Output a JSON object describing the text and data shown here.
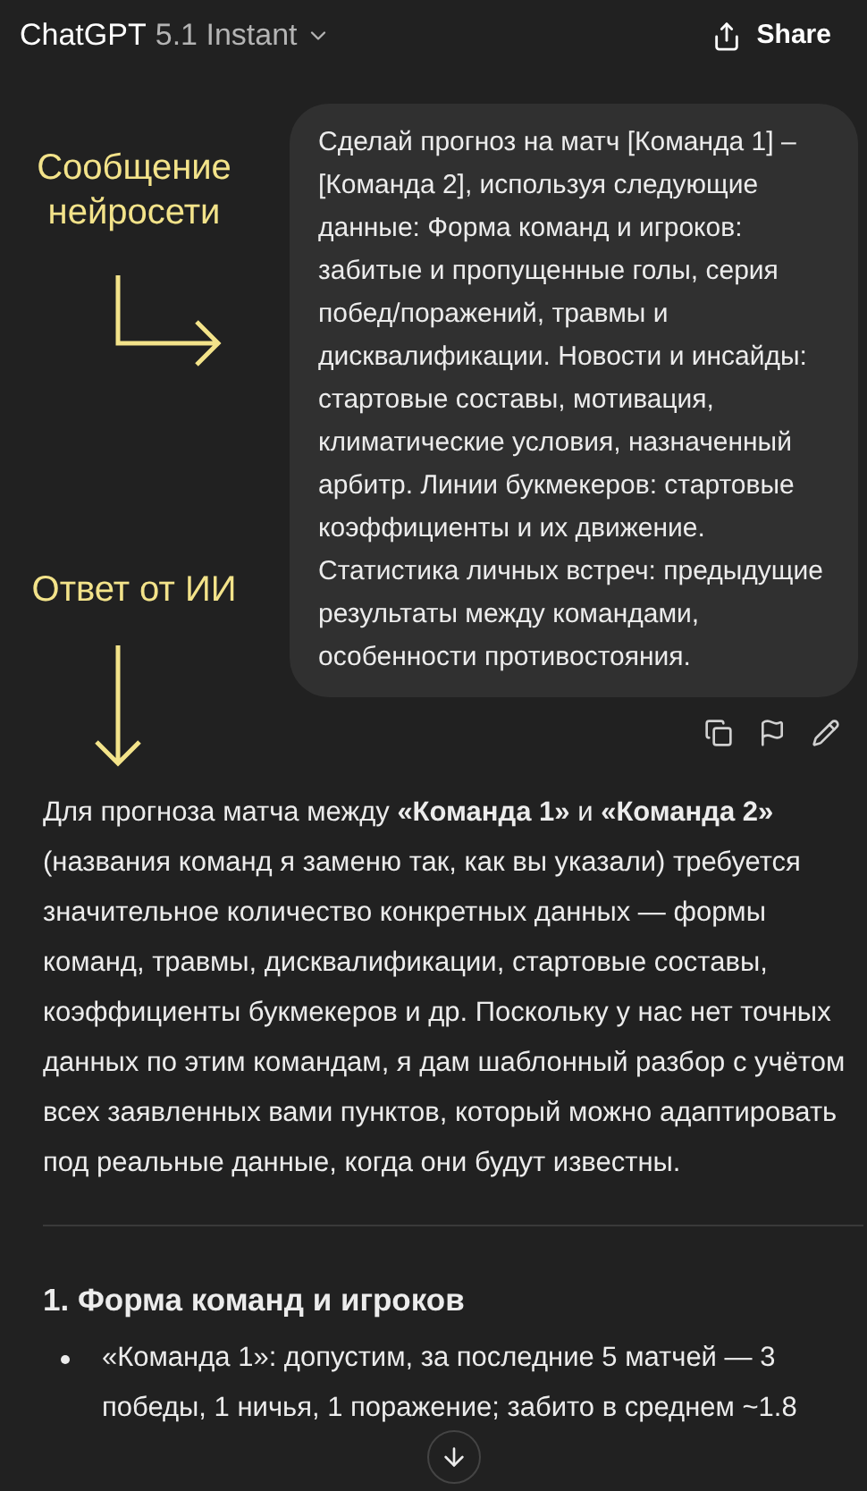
{
  "header": {
    "title": "ChatGPT",
    "model": "5.1 Instant",
    "share": "Share"
  },
  "annotations": [
    {
      "text": "Сообщение нейросети",
      "kind": "bent"
    },
    {
      "text": "Ответ от ИИ",
      "kind": "down"
    }
  ],
  "user_message": "Сделай прогноз на матч [Команда 1] – [Команда 2], используя следующие данные: Форма команд и игроков: забитые и пропущенные голы, серия побед/поражений, травмы и дисквалификации. Новости и инсайды: стартовые составы, мотивация, климатические условия, назначенный арбитр. Линии букмекеров: стартовые коэффициенты и их движение. Статистика личных встреч: предыдущие результаты между командами, особенности противостояния.",
  "answer": {
    "intro": "Для прогноза матча между **«Команда 1»** и **«Команда 2»** (названия команд я заменю так, как вы указали) требуется значительное количество конкретных данных — формы команд, травмы, дисквалификации, стартовые составы, коэффициенты букмекеров и др. Поскольку у нас нет точных данных по этим командам, я дам шаблонный разбор с учётом всех заявленных вами пунктов, который можно адаптировать под реальные данные, когда они будут известны.",
    "heading": "1. Форма команд и игроков",
    "bullets": [
      "«Команда 1»: допустим, за последние 5 матчей — 3 победы, 1 ничья, 1 поражение; забито в среднем ~1.8"
    ]
  }
}
